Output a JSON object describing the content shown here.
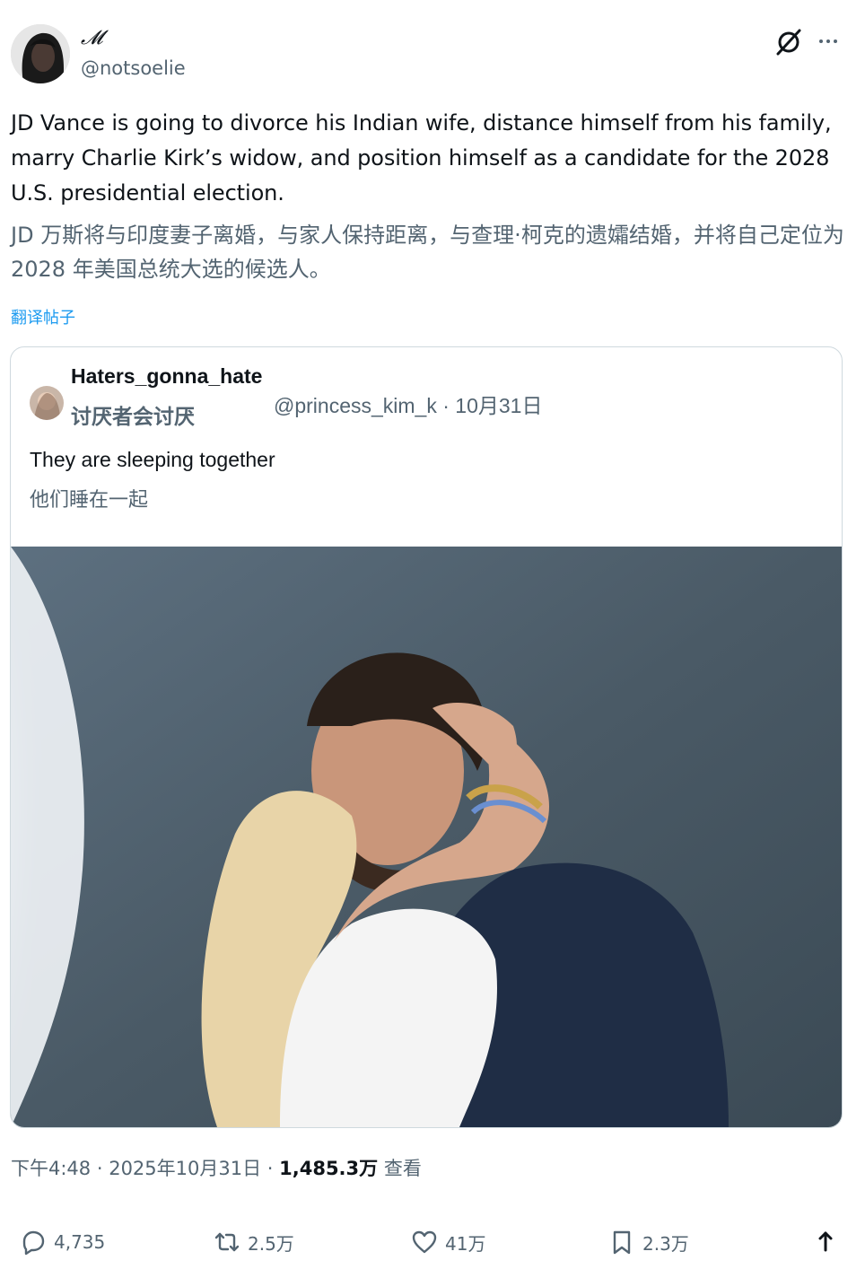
{
  "author": {
    "display_name": "𝓜",
    "handle": "@notsoelie",
    "avatar_icon": "user-avatar"
  },
  "post": {
    "text": "JD Vance is going to divorce his Indian wife, distance himself from his family, marry Charlie Kirk’s widow, and position himself as a candidate for the 2028 U.S. presidential election.",
    "translation": "JD 万斯将与印度妻子离婚，与家人保持距离，与查理·柯克的遗孀结婚，并将自己定位为 2028 年美国总统大选的候选人。",
    "translate_link": "翻译帖子"
  },
  "quote": {
    "name": "Haters_gonna_hate",
    "name_translation": "讨厌者会讨厌",
    "handle_date": "@princess_kim_k · 10月31日",
    "text": "They are sleeping together",
    "text_translation": "他们睡在一起"
  },
  "footer": {
    "time": "下午4:48",
    "date": "2025年10月31日",
    "views_count": "1,485.3万",
    "views_label": "查看"
  },
  "actions": {
    "replies": "4,735",
    "retweets": "2.5万",
    "likes": "41万",
    "bookmarks": "2.3万"
  },
  "colors": {
    "accent": "#1d9bf0",
    "text_primary": "#0f1419",
    "text_secondary": "#536471",
    "border": "#cfd9de"
  }
}
